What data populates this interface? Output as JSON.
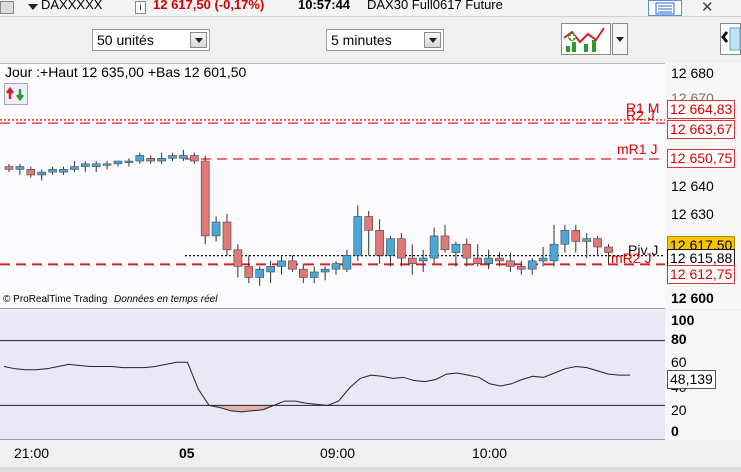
{
  "topbar": {
    "symbol": "DAXXXXX",
    "price_change": "12 617,50 (-0,17%)",
    "time": "10:57:44",
    "instrument": "DAX30 Full0617 Future"
  },
  "toolbar": {
    "units_select": "50 unités",
    "interval_select": "5 minutes"
  },
  "chart": {
    "info_line": "Jour :+Haut 12 635,00 +Bas 12 601,50",
    "copyright": "© ProRealTime Trading",
    "realtime_note": "Données en temps réel",
    "line_labels": {
      "r1m": "R1 M",
      "r2j": "R2 J",
      "mr1j": "mR1 J",
      "pivj": "Piv J",
      "mr2j": "mR2 J"
    },
    "price_axis": [
      "12 680",
      "12 670",
      "12 640",
      "12 630",
      "12 600"
    ],
    "price_tags": {
      "r1m": "12 664,83",
      "r2j": "12 663,67",
      "mr1j": "12 650,75",
      "last": "12 617,50",
      "piv": "12 615,88",
      "mr2": "12 612,75"
    },
    "indicator_axis": [
      "100",
      "80",
      "60",
      "40",
      "20",
      "0"
    ],
    "indicator_value": "48,139",
    "time_axis": [
      "21:00",
      "05",
      "09:00",
      "10:00"
    ]
  },
  "colors": {
    "up": "#4aa8d8",
    "down": "#e07878",
    "level_line": "#e02020",
    "indicator_fill": "#e3b0b0"
  },
  "chart_data": {
    "type": "candlestick",
    "ylim": [
      12597,
      12685
    ],
    "candles": [
      {
        "o": 12648,
        "h": 12649,
        "l": 12646,
        "c": 12647
      },
      {
        "o": 12647,
        "h": 12649,
        "l": 12645,
        "c": 12648
      },
      {
        "o": 12647,
        "h": 12648,
        "l": 12644,
        "c": 12645
      },
      {
        "o": 12645,
        "h": 12647,
        "l": 12643,
        "c": 12646
      },
      {
        "o": 12646,
        "h": 12648,
        "l": 12645,
        "c": 12647
      },
      {
        "o": 12646,
        "h": 12648,
        "l": 12645,
        "c": 12647
      },
      {
        "o": 12647,
        "h": 12650,
        "l": 12646,
        "c": 12648
      },
      {
        "o": 12648,
        "h": 12650,
        "l": 12646,
        "c": 12649
      },
      {
        "o": 12648,
        "h": 12650,
        "l": 12646,
        "c": 12649
      },
      {
        "o": 12649,
        "h": 12650,
        "l": 12647,
        "c": 12649
      },
      {
        "o": 12649,
        "h": 12650,
        "l": 12648,
        "c": 12650
      },
      {
        "o": 12650,
        "h": 12651,
        "l": 12648,
        "c": 12650
      },
      {
        "o": 12650,
        "h": 12653,
        "l": 12649,
        "c": 12652
      },
      {
        "o": 12651,
        "h": 12652,
        "l": 12649,
        "c": 12650
      },
      {
        "o": 12650,
        "h": 12653,
        "l": 12649,
        "c": 12651
      },
      {
        "o": 12651,
        "h": 12653,
        "l": 12650,
        "c": 12652
      },
      {
        "o": 12651,
        "h": 12654,
        "l": 12650,
        "c": 12652
      },
      {
        "o": 12652,
        "h": 12653,
        "l": 12649,
        "c": 12650
      },
      {
        "o": 12650,
        "h": 12652,
        "l": 12620,
        "c": 12623
      },
      {
        "o": 12623,
        "h": 12630,
        "l": 12621,
        "c": 12628
      },
      {
        "o": 12628,
        "h": 12631,
        "l": 12616,
        "c": 12618
      },
      {
        "o": 12618,
        "h": 12620,
        "l": 12608,
        "c": 12612
      },
      {
        "o": 12612,
        "h": 12616,
        "l": 12606,
        "c": 12608
      },
      {
        "o": 12608,
        "h": 12612,
        "l": 12605,
        "c": 12611
      },
      {
        "o": 12610,
        "h": 12614,
        "l": 12606,
        "c": 12612
      },
      {
        "o": 12612,
        "h": 12616,
        "l": 12609,
        "c": 12614
      },
      {
        "o": 12614,
        "h": 12616,
        "l": 12610,
        "c": 12611
      },
      {
        "o": 12611,
        "h": 12613,
        "l": 12606,
        "c": 12608
      },
      {
        "o": 12608,
        "h": 12612,
        "l": 12606,
        "c": 12610
      },
      {
        "o": 12610,
        "h": 12612,
        "l": 12607,
        "c": 12611
      },
      {
        "o": 12611,
        "h": 12614,
        "l": 12609,
        "c": 12613
      },
      {
        "o": 12611,
        "h": 12618,
        "l": 12610,
        "c": 12616
      },
      {
        "o": 12616,
        "h": 12634,
        "l": 12614,
        "c": 12630
      },
      {
        "o": 12630,
        "h": 12632,
        "l": 12616,
        "c": 12625
      },
      {
        "o": 12625,
        "h": 12629,
        "l": 12613,
        "c": 12616
      },
      {
        "o": 12616,
        "h": 12623,
        "l": 12612,
        "c": 12622
      },
      {
        "o": 12622,
        "h": 12624,
        "l": 12612,
        "c": 12615
      },
      {
        "o": 12615,
        "h": 12620,
        "l": 12609,
        "c": 12613
      },
      {
        "o": 12614,
        "h": 12618,
        "l": 12610,
        "c": 12615
      },
      {
        "o": 12615,
        "h": 12626,
        "l": 12613,
        "c": 12623
      },
      {
        "o": 12623,
        "h": 12627,
        "l": 12617,
        "c": 12618
      },
      {
        "o": 12617,
        "h": 12621,
        "l": 12612,
        "c": 12620
      },
      {
        "o": 12620,
        "h": 12622,
        "l": 12612,
        "c": 12615
      },
      {
        "o": 12615,
        "h": 12620,
        "l": 12612,
        "c": 12613
      },
      {
        "o": 12613,
        "h": 12618,
        "l": 12611,
        "c": 12615
      },
      {
        "o": 12615,
        "h": 12617,
        "l": 12612,
        "c": 12614
      },
      {
        "o": 12614,
        "h": 12617,
        "l": 12610,
        "c": 12612
      },
      {
        "o": 12612,
        "h": 12614,
        "l": 12609,
        "c": 12611
      },
      {
        "o": 12611,
        "h": 12615,
        "l": 12609,
        "c": 12614
      },
      {
        "o": 12614,
        "h": 12619,
        "l": 12612,
        "c": 12615
      },
      {
        "o": 12614,
        "h": 12627,
        "l": 12612,
        "c": 12620
      },
      {
        "o": 12620,
        "h": 12627,
        "l": 12617,
        "c": 12625
      },
      {
        "o": 12625,
        "h": 12627,
        "l": 12617,
        "c": 12621
      },
      {
        "o": 12621,
        "h": 12624,
        "l": 12615,
        "c": 12622
      },
      {
        "o": 12622,
        "h": 12623,
        "l": 12616,
        "c": 12619
      },
      {
        "o": 12619,
        "h": 12620,
        "l": 12613,
        "c": 12617
      }
    ],
    "levels": [
      {
        "name": "R1 M",
        "value": 12664.83,
        "style": "dotted"
      },
      {
        "name": "R2 J",
        "value": 12663.67,
        "style": "dashed"
      },
      {
        "name": "mR1 J",
        "value": 12650.75,
        "style": "dashed"
      },
      {
        "name": "Piv J",
        "value": 12615.88,
        "style": "dotted-black"
      },
      {
        "name": "mR2 J",
        "value": 12612.75,
        "style": "dashed"
      }
    ],
    "indicator": {
      "ylim": [
        0,
        100
      ],
      "upper": 80,
      "lower": 20,
      "last": 48.139,
      "values": [
        56,
        54,
        53,
        53,
        54,
        56,
        58,
        57,
        56,
        56,
        56,
        55,
        55,
        55,
        56,
        58,
        60,
        60,
        35,
        20,
        18,
        15,
        14,
        15,
        16,
        20,
        24,
        24,
        22,
        21,
        20,
        24,
        36,
        45,
        48,
        47,
        45,
        46,
        43,
        42,
        44,
        49,
        50,
        48,
        46,
        40,
        38,
        40,
        44,
        47,
        46,
        50,
        54,
        56,
        55,
        52,
        49,
        48,
        48
      ]
    },
    "time_labels": [
      "21:00",
      "05",
      "09:00",
      "10:00"
    ]
  }
}
